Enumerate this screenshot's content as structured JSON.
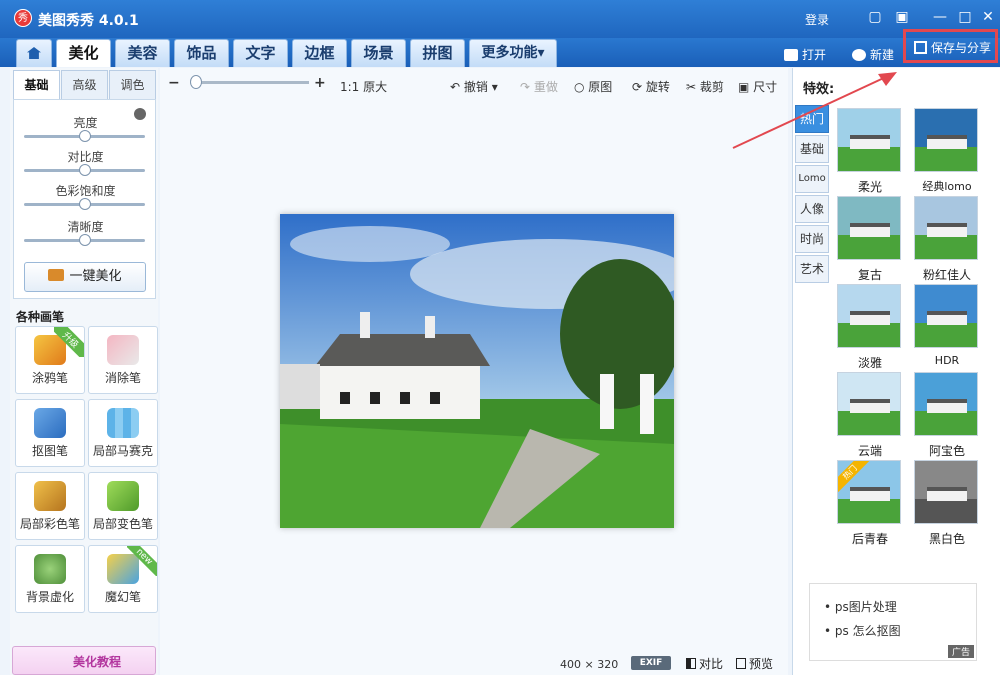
{
  "app": {
    "logo_text": "秀",
    "title": "美图秀秀 4.0.1",
    "login": "登录"
  },
  "window_controls": {
    "feedback_icon": "speech-bubble-icon",
    "skin_icon": "shirt-icon",
    "minimize": "—",
    "maximize": "□",
    "close": "✕"
  },
  "tabs": [
    {
      "label": "",
      "icon": "home-icon"
    },
    {
      "label": "美化",
      "active": true
    },
    {
      "label": "美容"
    },
    {
      "label": "饰品"
    },
    {
      "label": "文字"
    },
    {
      "label": "边框"
    },
    {
      "label": "场景"
    },
    {
      "label": "拼图"
    },
    {
      "label": "更多功能▾"
    }
  ],
  "top_actions": {
    "open": "打开",
    "new": "新建",
    "save_share": "保存与分享"
  },
  "left": {
    "subtabs": [
      "基础",
      "高级",
      "调色"
    ],
    "sliders": [
      {
        "label": "亮度",
        "value": 0.5
      },
      {
        "label": "对比度",
        "value": 0.5
      },
      {
        "label": "色彩饱和度",
        "value": 0.5
      },
      {
        "label": "清晰度",
        "value": 0.5
      }
    ],
    "auto_beautify": "一键美化",
    "brush_title": "各种画笔",
    "brushes": [
      {
        "label": "涂鸦笔",
        "badge": "升级"
      },
      {
        "label": "消除笔",
        "badge": ""
      },
      {
        "label": "抠图笔",
        "badge": ""
      },
      {
        "label": "局部马赛克",
        "badge": ""
      },
      {
        "label": "局部彩色笔",
        "badge": ""
      },
      {
        "label": "局部变色笔",
        "badge": ""
      },
      {
        "label": "背景虚化",
        "badge": ""
      },
      {
        "label": "魔幻笔",
        "badge": "new"
      }
    ],
    "tutorial": "美化教程"
  },
  "toolbar": {
    "zoom_out": "−",
    "zoom_in": "+",
    "actual_size": "1:1 原大",
    "undo": "撤销",
    "redo": "重做",
    "original": "原图",
    "rotate": "旋转",
    "crop": "裁剪",
    "resize": "尺寸"
  },
  "canvas": {
    "size_text": "400 × 320",
    "exif": "EXIF",
    "compare": "对比",
    "preview": "预览"
  },
  "effects": {
    "title": "特效:",
    "categories": [
      "热门",
      "基础",
      "Lomo",
      "人像",
      "时尚",
      "艺术"
    ],
    "items": [
      {
        "label": "柔光",
        "tint": "#9fd0e8",
        "badge": ""
      },
      {
        "label": "经典lomo",
        "tint": "#2a6fb0",
        "badge": ""
      },
      {
        "label": "复古",
        "tint": "#7fb9c2",
        "badge": ""
      },
      {
        "label": "粉红佳人",
        "tint": "#a8c6e0",
        "badge": ""
      },
      {
        "label": "淡雅",
        "tint": "#b6d8ee",
        "badge": ""
      },
      {
        "label": "HDR",
        "tint": "#3f8bd0",
        "badge": ""
      },
      {
        "label": "云端",
        "tint": "#cfe6f3",
        "badge": ""
      },
      {
        "label": "阿宝色",
        "tint": "#4ba0d8",
        "badge": ""
      },
      {
        "label": "后青春",
        "tint": "#8cc6e8",
        "badge": "热门"
      },
      {
        "label": "黑白色",
        "tint": "#888888",
        "badge": ""
      }
    ]
  },
  "ad": {
    "links": [
      "ps图片处理",
      "ps 怎么抠图"
    ],
    "tag": "广告"
  },
  "colors": {
    "accent": "#2f7fd6",
    "highlight": "#e2484f"
  }
}
